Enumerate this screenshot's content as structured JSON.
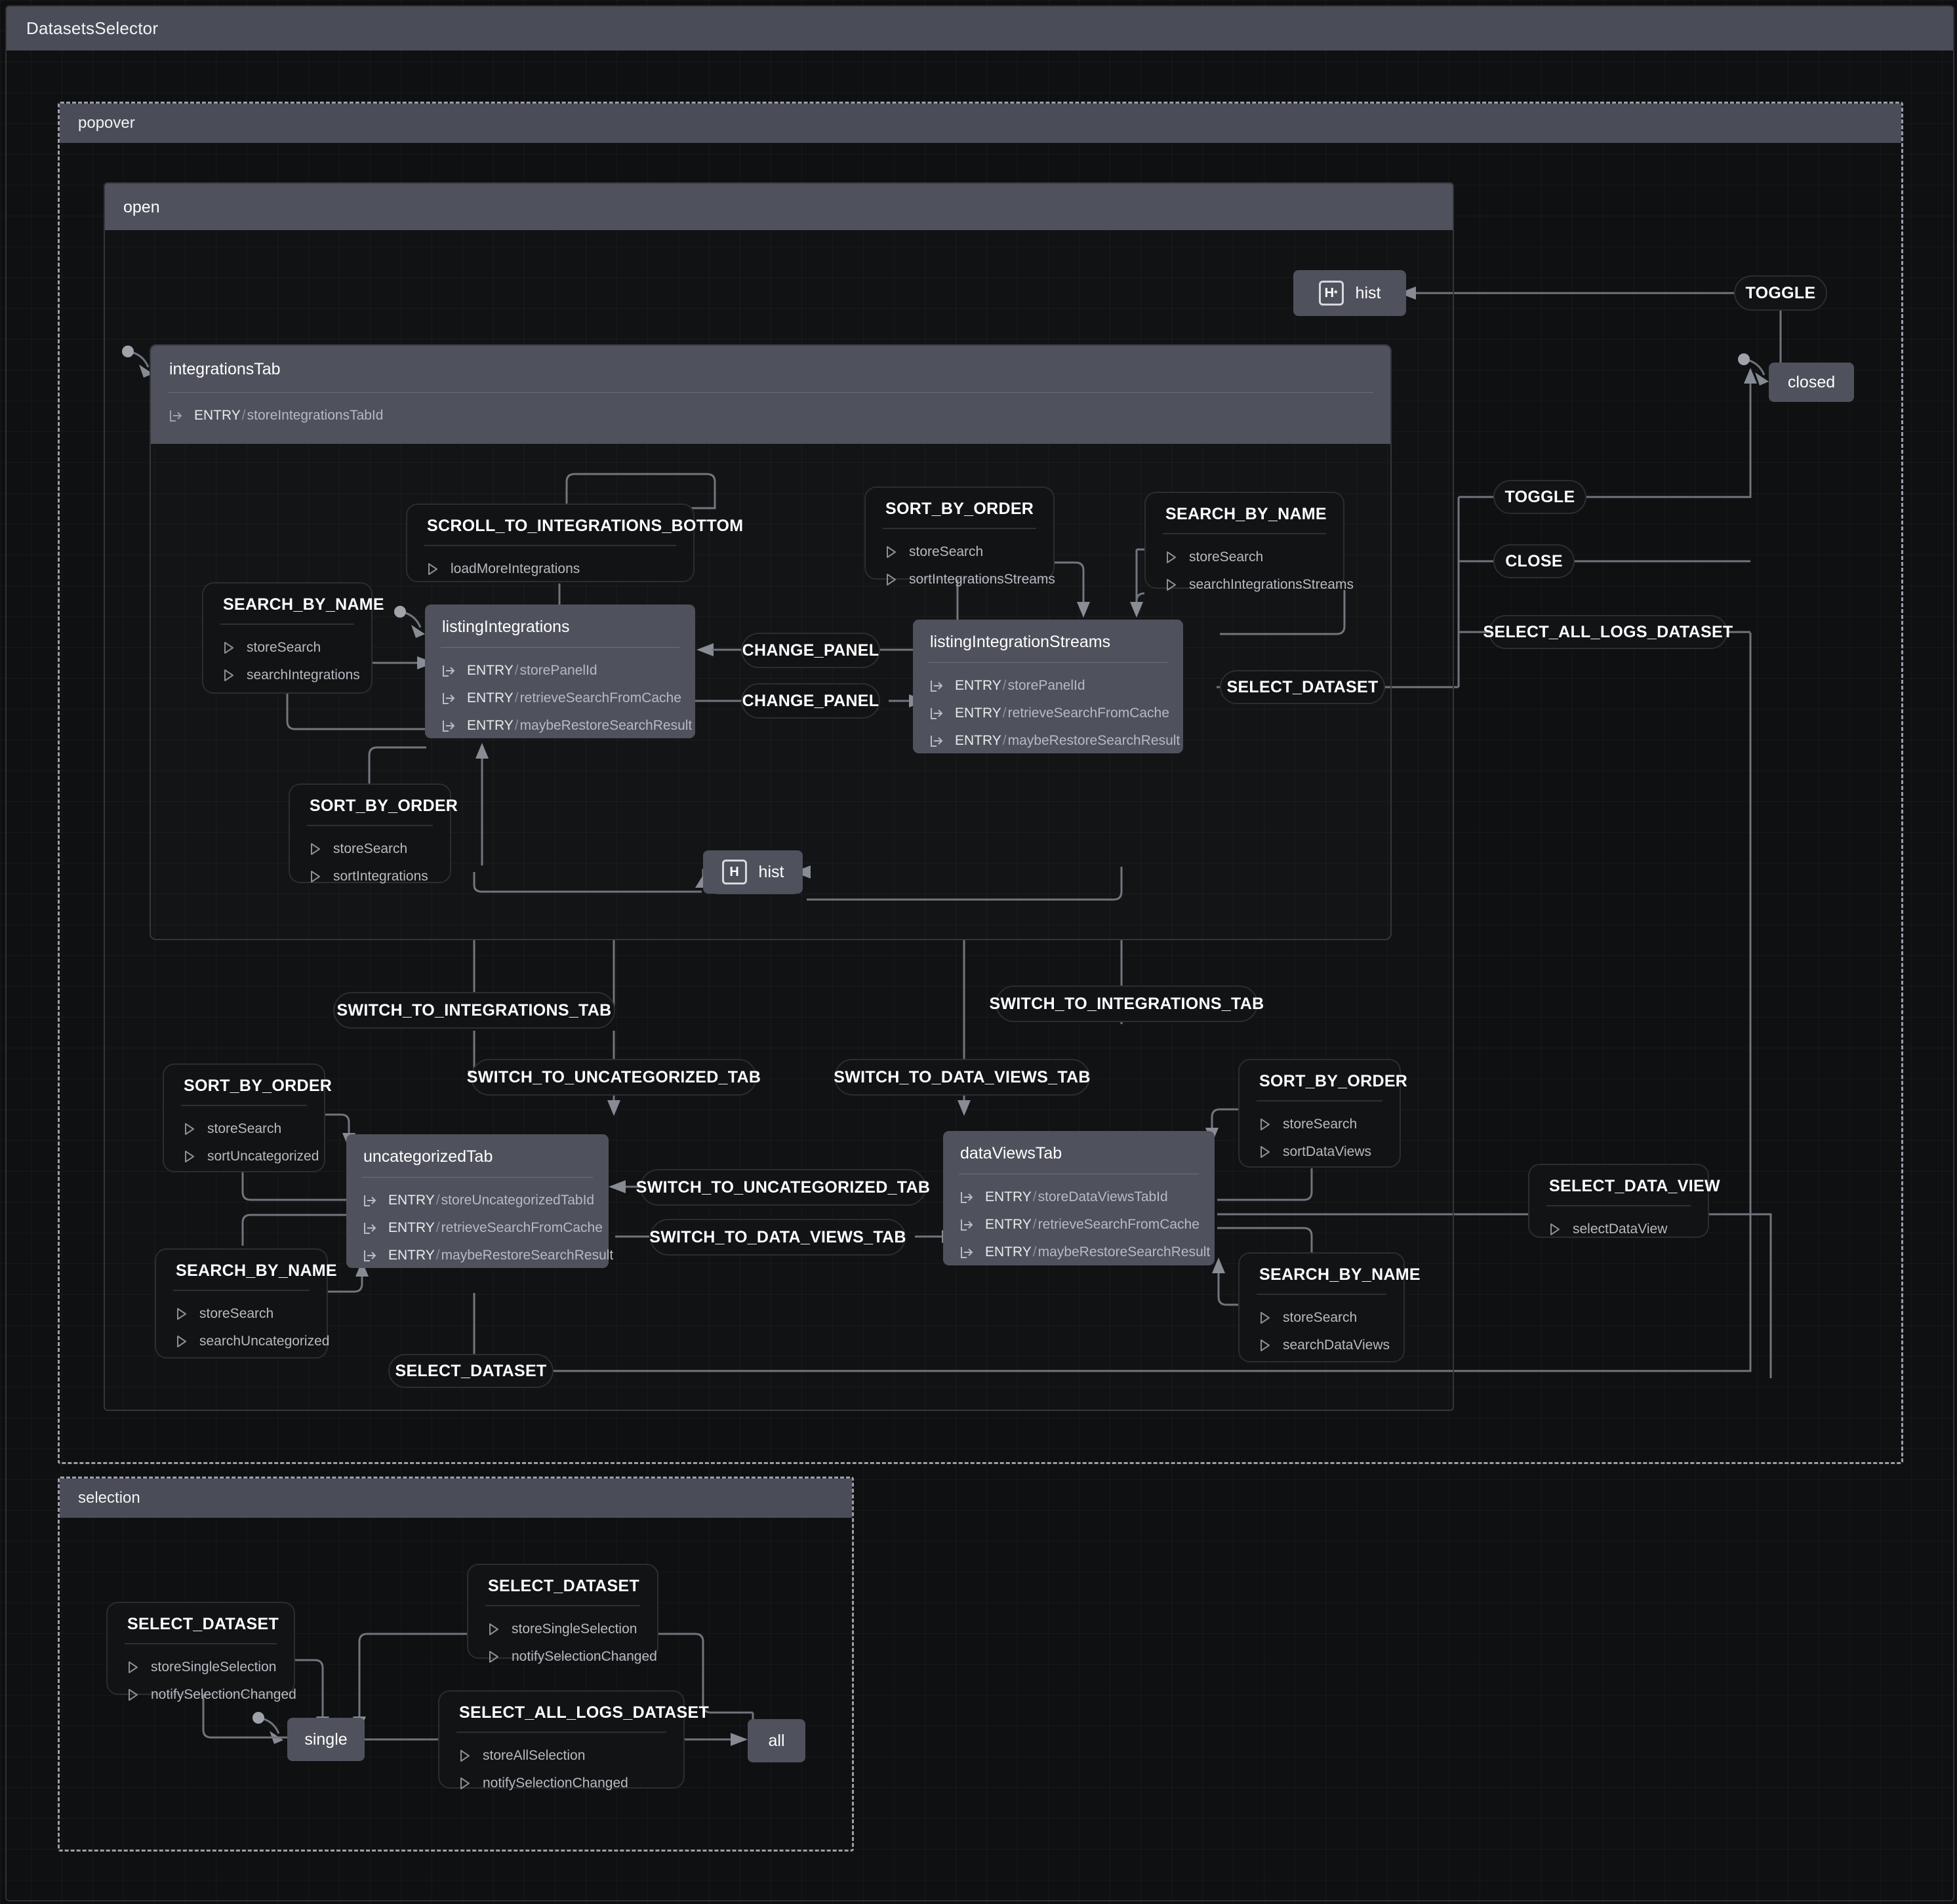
{
  "machine": {
    "title": "DatasetsSelector"
  },
  "regions": {
    "popover": {
      "label": "popover"
    },
    "selection": {
      "label": "selection"
    }
  },
  "states": {
    "open": {
      "label": "open"
    },
    "closed": {
      "label": "closed"
    },
    "integrationsTab": {
      "label": "integrationsTab",
      "actions": [
        {
          "kind": "entry",
          "keyword": "ENTRY",
          "sep": "/",
          "name": "storeIntegrationsTabId"
        }
      ]
    },
    "listingIntegrations": {
      "label": "listingIntegrations",
      "actions": [
        {
          "kind": "entry",
          "keyword": "ENTRY",
          "sep": "/",
          "name": "storePanelId"
        },
        {
          "kind": "entry",
          "keyword": "ENTRY",
          "sep": "/",
          "name": "retrieveSearchFromCache"
        },
        {
          "kind": "entry",
          "keyword": "ENTRY",
          "sep": "/",
          "name": "maybeRestoreSearchResult"
        }
      ]
    },
    "listingIntegrationStreams": {
      "label": "listingIntegrationStreams",
      "actions": [
        {
          "kind": "entry",
          "keyword": "ENTRY",
          "sep": "/",
          "name": "storePanelId"
        },
        {
          "kind": "entry",
          "keyword": "ENTRY",
          "sep": "/",
          "name": "retrieveSearchFromCache"
        },
        {
          "kind": "entry",
          "keyword": "ENTRY",
          "sep": "/",
          "name": "maybeRestoreSearchResult"
        }
      ]
    },
    "uncategorizedTab": {
      "label": "uncategorizedTab",
      "actions": [
        {
          "kind": "entry",
          "keyword": "ENTRY",
          "sep": "/",
          "name": "storeUncategorizedTabId"
        },
        {
          "kind": "entry",
          "keyword": "ENTRY",
          "sep": "/",
          "name": "retrieveSearchFromCache"
        },
        {
          "kind": "entry",
          "keyword": "ENTRY",
          "sep": "/",
          "name": "maybeRestoreSearchResult"
        }
      ]
    },
    "dataViewsTab": {
      "label": "dataViewsTab",
      "actions": [
        {
          "kind": "entry",
          "keyword": "ENTRY",
          "sep": "/",
          "name": "storeDataViewsTabId"
        },
        {
          "kind": "entry",
          "keyword": "ENTRY",
          "sep": "/",
          "name": "retrieveSearchFromCache"
        },
        {
          "kind": "entry",
          "keyword": "ENTRY",
          "sep": "/",
          "name": "maybeRestoreSearchResult"
        }
      ]
    },
    "single": {
      "label": "single"
    },
    "all": {
      "label": "all"
    },
    "hist_deep": {
      "label": "hist",
      "icon": "H",
      "deep": "*"
    },
    "hist_shallow": {
      "label": "hist",
      "icon": "H",
      "deep": ""
    }
  },
  "events": {
    "toggle_top": {
      "label": "TOGGLE"
    },
    "toggle_mid": {
      "label": "TOGGLE"
    },
    "close": {
      "label": "CLOSE"
    },
    "select_all_logs_dataset_right": {
      "label": "SELECT_ALL_LOGS_DATASET"
    },
    "select_dataset_streams": {
      "label": "SELECT_DATASET"
    },
    "select_dataset_bottom": {
      "label": "SELECT_DATASET"
    },
    "change_panel_1": {
      "label": "CHANGE_PANEL"
    },
    "change_panel_2": {
      "label": "CHANGE_PANEL"
    },
    "switch_to_integrations_tab_left": {
      "label": "SWITCH_TO_INTEGRATIONS_TAB"
    },
    "switch_to_integrations_tab_right": {
      "label": "SWITCH_TO_INTEGRATIONS_TAB"
    },
    "switch_to_uncategorized_tab_top": {
      "label": "SWITCH_TO_UNCATEGORIZED_TAB"
    },
    "switch_to_uncategorized_tab_mid": {
      "label": "SWITCH_TO_UNCATEGORIZED_TAB"
    },
    "switch_to_data_views_tab_top": {
      "label": "SWITCH_TO_DATA_VIEWS_TAB"
    },
    "switch_to_data_views_tab_mid": {
      "label": "SWITCH_TO_DATA_VIEWS_TAB"
    },
    "scroll_to_integrations_bottom": {
      "label": "SCROLL_TO_INTEGRATIONS_BOTTOM",
      "actions": [
        {
          "kind": "action",
          "name": "loadMoreIntegrations"
        }
      ]
    },
    "search_by_name_integrations": {
      "label": "SEARCH_BY_NAME",
      "actions": [
        {
          "kind": "action",
          "name": "storeSearch"
        },
        {
          "kind": "action",
          "name": "searchIntegrations"
        }
      ]
    },
    "sort_by_order_integrations": {
      "label": "SORT_BY_ORDER",
      "actions": [
        {
          "kind": "action",
          "name": "storeSearch"
        },
        {
          "kind": "action",
          "name": "sortIntegrations"
        }
      ]
    },
    "sort_by_order_streams": {
      "label": "SORT_BY_ORDER",
      "actions": [
        {
          "kind": "action",
          "name": "storeSearch"
        },
        {
          "kind": "action",
          "name": "sortIntegrationsStreams"
        }
      ]
    },
    "search_by_name_streams": {
      "label": "SEARCH_BY_NAME",
      "actions": [
        {
          "kind": "action",
          "name": "storeSearch"
        },
        {
          "kind": "action",
          "name": "searchIntegrationsStreams"
        }
      ]
    },
    "sort_by_order_uncategorized": {
      "label": "SORT_BY_ORDER",
      "actions": [
        {
          "kind": "action",
          "name": "storeSearch"
        },
        {
          "kind": "action",
          "name": "sortUncategorized"
        }
      ]
    },
    "search_by_name_uncategorized": {
      "label": "SEARCH_BY_NAME",
      "actions": [
        {
          "kind": "action",
          "name": "storeSearch"
        },
        {
          "kind": "action",
          "name": "searchUncategorized"
        }
      ]
    },
    "sort_by_order_dataviews": {
      "label": "SORT_BY_ORDER",
      "actions": [
        {
          "kind": "action",
          "name": "storeSearch"
        },
        {
          "kind": "action",
          "name": "sortDataViews"
        }
      ]
    },
    "search_by_name_dataviews": {
      "label": "SEARCH_BY_NAME",
      "actions": [
        {
          "kind": "action",
          "name": "storeSearch"
        },
        {
          "kind": "action",
          "name": "searchDataViews"
        }
      ]
    },
    "select_data_view": {
      "label": "SELECT_DATA_VIEW",
      "actions": [
        {
          "kind": "action",
          "name": "selectDataView"
        }
      ]
    },
    "sel_select_dataset_left": {
      "label": "SELECT_DATASET",
      "actions": [
        {
          "kind": "action",
          "name": "storeSingleSelection"
        },
        {
          "kind": "action",
          "name": "notifySelectionChanged"
        }
      ]
    },
    "sel_select_dataset_top": {
      "label": "SELECT_DATASET",
      "actions": [
        {
          "kind": "action",
          "name": "storeSingleSelection"
        },
        {
          "kind": "action",
          "name": "notifySelectionChanged"
        }
      ]
    },
    "sel_select_all_logs_dataset": {
      "label": "SELECT_ALL_LOGS_DATASET",
      "actions": [
        {
          "kind": "action",
          "name": "storeAllSelection"
        },
        {
          "kind": "action",
          "name": "notifySelectionChanged"
        }
      ]
    }
  },
  "colors": {
    "canvas": "#0e0f11",
    "state_fill": "#4f525c",
    "event_fill": "#121315",
    "edge": "#6f737b",
    "region_border": "#9aa0ab",
    "text": "#ffffff",
    "action_text": "#b7bac0"
  }
}
